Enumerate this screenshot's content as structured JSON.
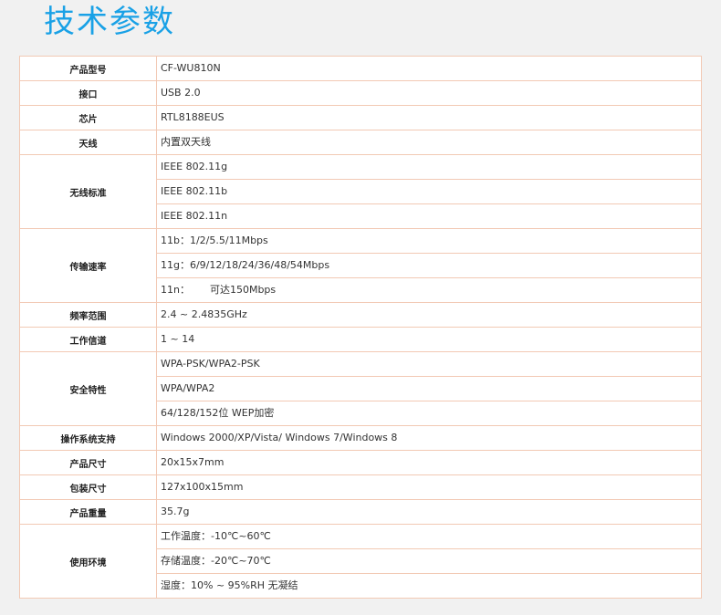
{
  "title": "技术参数",
  "rows": [
    {
      "label": "产品型号",
      "values": [
        "CF-WU810N"
      ]
    },
    {
      "label": "接口",
      "values": [
        "USB 2.0"
      ]
    },
    {
      "label": "芯片",
      "values": [
        "RTL8188EUS"
      ]
    },
    {
      "label": "天线",
      "values": [
        "内置双天线"
      ]
    },
    {
      "label": "无线标准",
      "values": [
        "IEEE 802.11g",
        "IEEE 802.11b",
        "IEEE 802.11n"
      ]
    },
    {
      "label": "传输速率",
      "values": [
        "11b：1/2/5.5/11Mbps",
        "11g：6/9/12/18/24/36/48/54Mbps",
        "11n：",
        "可达150Mbps"
      ]
    },
    {
      "label": "频率范围",
      "values": [
        "2.4 ~ 2.4835GHz"
      ]
    },
    {
      "label": "工作信道",
      "values": [
        "1 ~ 14"
      ]
    },
    {
      "label": "安全特性",
      "values": [
        "WPA-PSK/WPA2-PSK",
        "WPA/WPA2",
        "64/128/152位 WEP加密"
      ]
    },
    {
      "label": "操作系统支持",
      "values": [
        "Windows 2000/XP/Vista/ Windows 7/Windows 8"
      ]
    },
    {
      "label": "产品尺寸",
      "values": [
        "20x15x7mm"
      ]
    },
    {
      "label": "包装尺寸",
      "values": [
        "127x100x15mm"
      ]
    },
    {
      "label": "产品重量",
      "values": [
        "35.7g"
      ]
    },
    {
      "label": "使用环境",
      "values": [
        "工作温度：-10℃~60℃",
        "存储温度：-20℃~70℃",
        "湿度：10% ~ 95%RH 无凝结"
      ]
    }
  ]
}
